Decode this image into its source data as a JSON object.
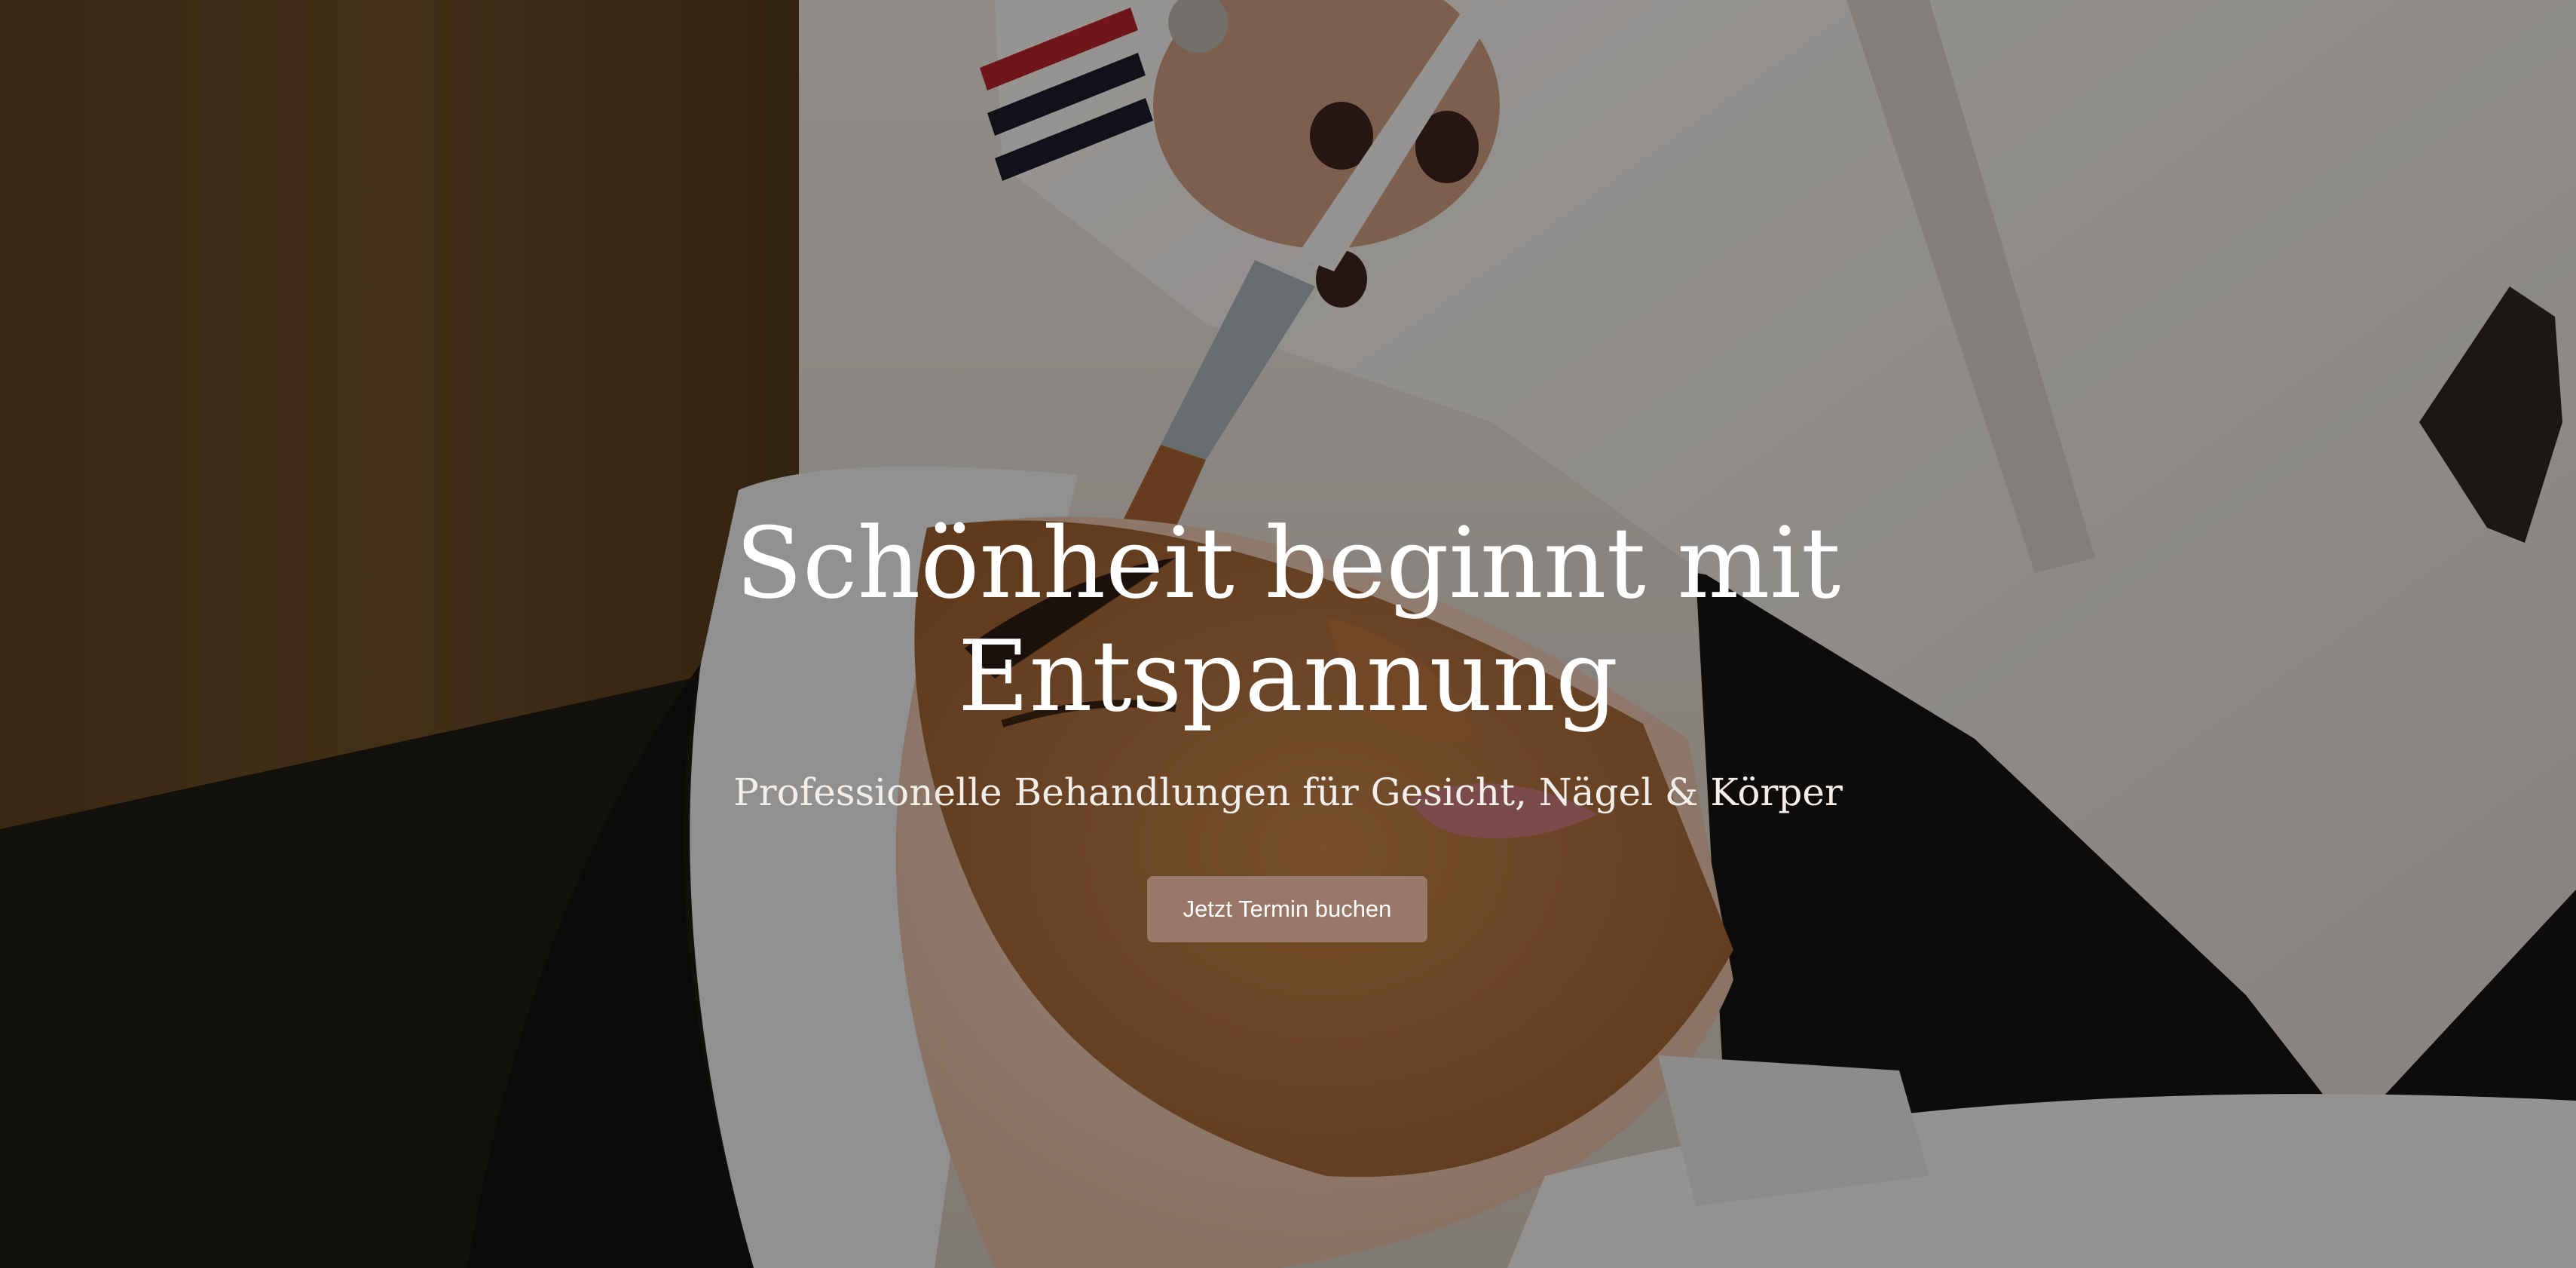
{
  "hero": {
    "headline_line1": "Schönheit beginnt mit",
    "headline_line2": "Entspannung",
    "subheadline": "Professionelle Behandlungen für Gesicht, Nägel & Körper",
    "cta_label": "Jetzt Termin buchen"
  },
  "colors": {
    "cta_background": "#9a7868",
    "text": "#ffffff",
    "overlay": "rgba(0,0,0,0.38)"
  },
  "icons": {
    "background_image": "spa-facial-mask-photo"
  }
}
